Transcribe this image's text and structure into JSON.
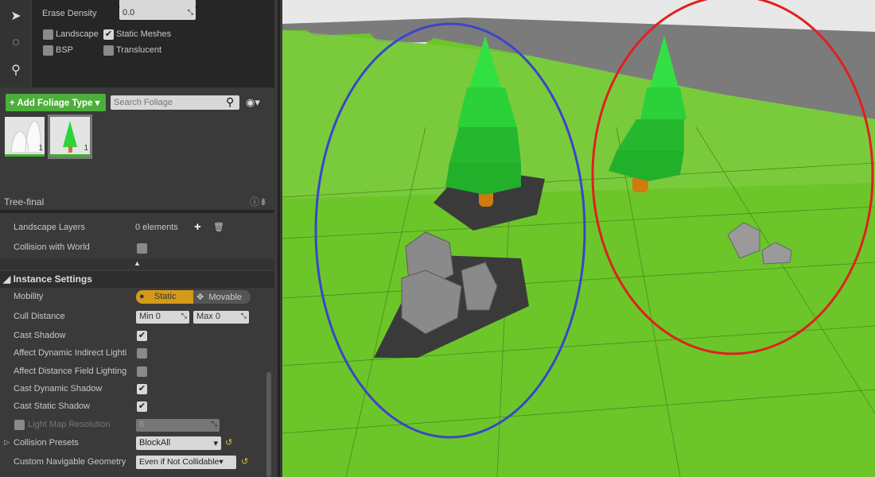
{
  "tools": {
    "icons": [
      "select-arrow-icon",
      "lasso-icon",
      "paint-bucket-icon"
    ]
  },
  "filters": {
    "erase_density_label": "Erase Density",
    "erase_density_value": "0.0",
    "landscape": "Landscape",
    "static_meshes": "Static Meshes",
    "bsp": "BSP",
    "translucent": "Translucent",
    "landscape_checked": false,
    "static_meshes_checked": true,
    "bsp_checked": false,
    "translucent_checked": false
  },
  "foliage": {
    "add_label": "+ Add Foliage Type",
    "search_placeholder": "Search Foliage",
    "items": [
      {
        "name": "rock",
        "count": "1"
      },
      {
        "name": "tree",
        "count": "1"
      }
    ],
    "selected": "Tree-final"
  },
  "details": {
    "landscape_layers_label": "Landscape Layers",
    "landscape_layers_value": "0 elements",
    "collision_world_label": "Collision with World",
    "instance_settings": "Instance Settings",
    "mobility_label": "Mobility",
    "mobility_static": "Static",
    "mobility_movable": "Movable",
    "cull_label": "Cull Distance",
    "cull_min_label": "Min",
    "cull_min": "0",
    "cull_max_label": "Max",
    "cull_max": "0",
    "cast_shadow": "Cast Shadow",
    "affect_dynamic": "Affect Dynamic Indirect Lighti",
    "affect_df": "Affect Distance Field Lighting",
    "cast_dynamic": "Cast Dynamic Shadow",
    "cast_static": "Cast Static Shadow",
    "light_map_label": "Light Map Resolution",
    "light_map_value": "8",
    "collision_presets_label": "Collision Presets",
    "collision_presets_value": "BlockAll",
    "nav_label": "Custom Navigable Geometry",
    "nav_value": "Even if Not Collidable"
  },
  "colors": {
    "accent_green": "#4caf3a",
    "mobility_active": "#d49a1a",
    "ground": "#6cc62a",
    "highlight_blue": "#3a46c8",
    "highlight_red": "#e02020"
  }
}
